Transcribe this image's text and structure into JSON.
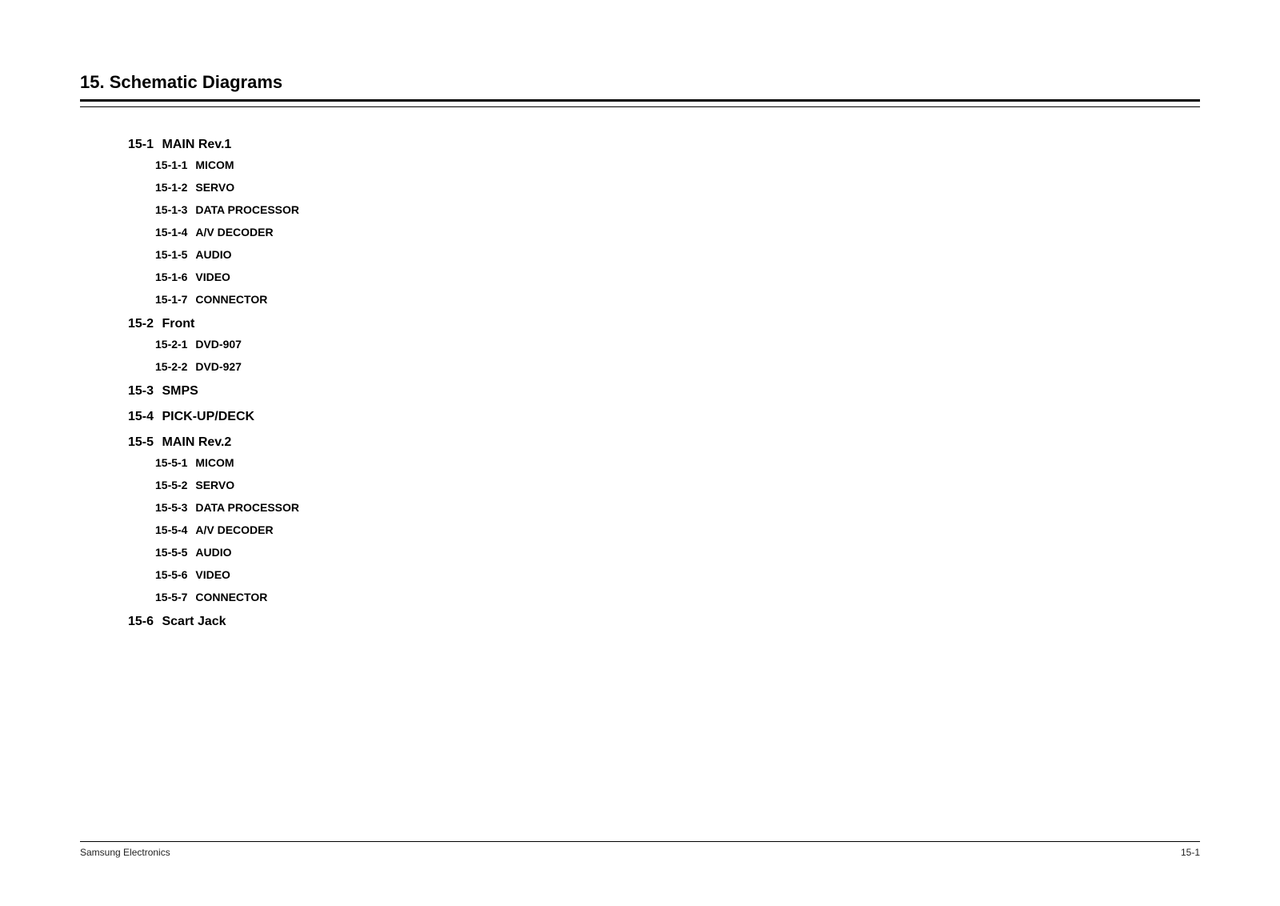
{
  "chapter": {
    "number": "15.",
    "title": "Schematic Diagrams"
  },
  "toc": [
    {
      "num": "15-1",
      "title": "MAIN Rev.1",
      "subs": [
        {
          "num": "15-1-1",
          "title": "MICOM"
        },
        {
          "num": "15-1-2",
          "title": "SERVO"
        },
        {
          "num": "15-1-3",
          "title": "DATA PROCESSOR"
        },
        {
          "num": "15-1-4",
          "title": "A/V DECODER"
        },
        {
          "num": "15-1-5",
          "title": "AUDIO"
        },
        {
          "num": "15-1-6",
          "title": "VIDEO"
        },
        {
          "num": "15-1-7",
          "title": "CONNECTOR"
        }
      ]
    },
    {
      "num": "15-2",
      "title": "Front",
      "subs": [
        {
          "num": "15-2-1",
          "title": "DVD-907"
        },
        {
          "num": "15-2-2",
          "title": "DVD-927"
        }
      ]
    },
    {
      "num": "15-3",
      "title": "SMPS",
      "subs": []
    },
    {
      "num": "15-4",
      "title": "PICK-UP/DECK",
      "subs": []
    },
    {
      "num": "15-5",
      "title": "MAIN Rev.2",
      "subs": [
        {
          "num": "15-5-1",
          "title": "MICOM"
        },
        {
          "num": "15-5-2",
          "title": "SERVO"
        },
        {
          "num": "15-5-3",
          "title": "DATA PROCESSOR"
        },
        {
          "num": "15-5-4",
          "title": "A/V DECODER"
        },
        {
          "num": "15-5-5",
          "title": "AUDIO"
        },
        {
          "num": "15-5-6",
          "title": "VIDEO"
        },
        {
          "num": "15-5-7",
          "title": "CONNECTOR"
        }
      ]
    },
    {
      "num": "15-6",
      "title": "Scart Jack",
      "subs": []
    }
  ],
  "footer": {
    "left": "Samsung Electronics",
    "right": "15-1"
  }
}
